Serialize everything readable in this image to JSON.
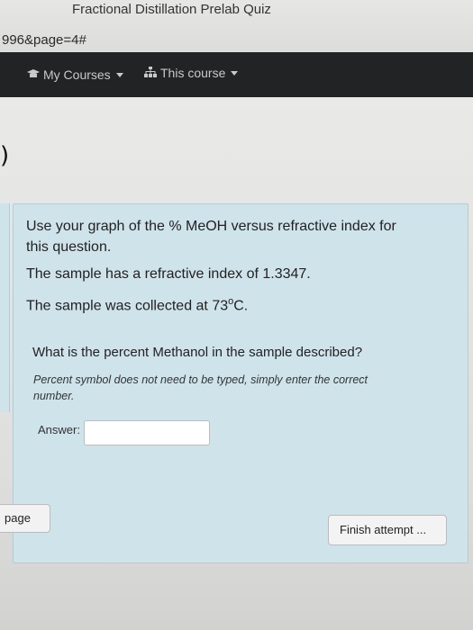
{
  "browser": {
    "tab_title": "Fractional Distillation Prelab Quiz",
    "url_fragment": "996&page=4#"
  },
  "navbar": {
    "items": [
      {
        "label": "My Courses",
        "icon": "mortarboard-icon"
      },
      {
        "label": "This course",
        "icon": "sitemap-icon"
      }
    ]
  },
  "left_fragment": ")",
  "question": {
    "intro_line1": "Use your graph of the % MeOH versus refractive index for",
    "intro_line2": "this question.",
    "refractive_line": "The sample has a refractive index of 1.3347.",
    "collected_prefix": "The sample was collected at 73",
    "degree": "o",
    "collected_suffix": "C.",
    "prompt": "What is the percent Methanol in the sample described?",
    "hint_line1": "Percent symbol does not need to be typed, simply enter the correct",
    "hint_line2": "number.",
    "answer_label": "Answer:",
    "answer_value": ""
  },
  "footer": {
    "page_button_label": "page",
    "finish_button_label": "Finish attempt ..."
  }
}
